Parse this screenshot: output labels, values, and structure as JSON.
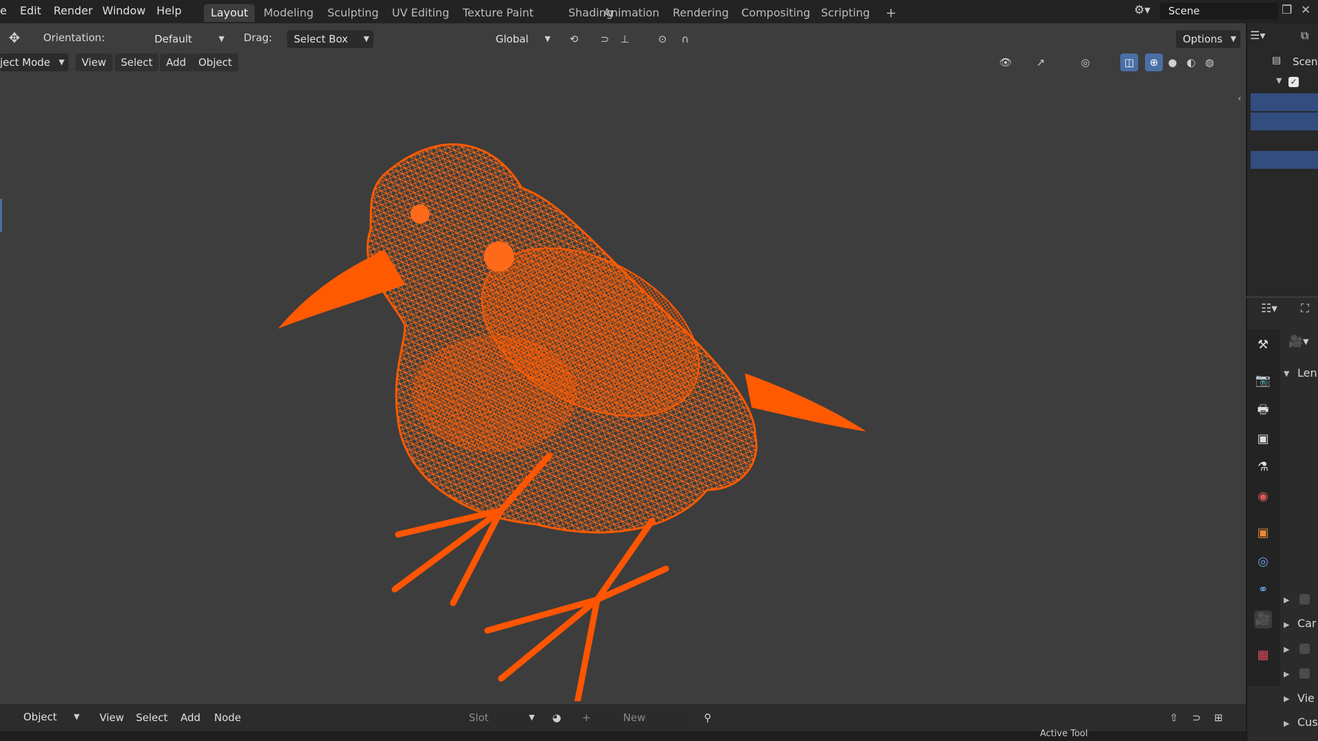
{
  "menu": {
    "file": "e",
    "edit": "Edit",
    "render": "Render",
    "window": "Window",
    "help": "Help"
  },
  "workspaces": [
    "Layout",
    "Modeling",
    "Sculpting",
    "UV Editing",
    "Texture Paint",
    "Shading",
    "Animation",
    "Rendering",
    "Compositing",
    "Scripting"
  ],
  "scene_name": "Scene",
  "tool_header": {
    "orientation_label": "Orientation:",
    "orientation_value": "Default",
    "drag_label": "Drag:",
    "drag_value": "Select Box",
    "transform_orientation": "Global",
    "options": "Options"
  },
  "viewport_header": {
    "mode": "ject Mode",
    "view": "View",
    "select": "Select",
    "add": "Add",
    "object": "Object"
  },
  "bottom_header": {
    "editor": "Object",
    "view": "View",
    "select": "Select",
    "add": "Add",
    "node": "Node",
    "slot": "Slot",
    "new": "New",
    "active_tool": "Active Tool"
  },
  "outliner": {
    "root": "Scene"
  },
  "properties": {
    "section_lens": "Len",
    "section_camera": "Car",
    "section_view": "Vie",
    "section_custom": "Cus"
  },
  "colors": {
    "accent": "#4a6fa5",
    "wire": "#ff5500",
    "viewport_bg": "#3d3d3d"
  }
}
